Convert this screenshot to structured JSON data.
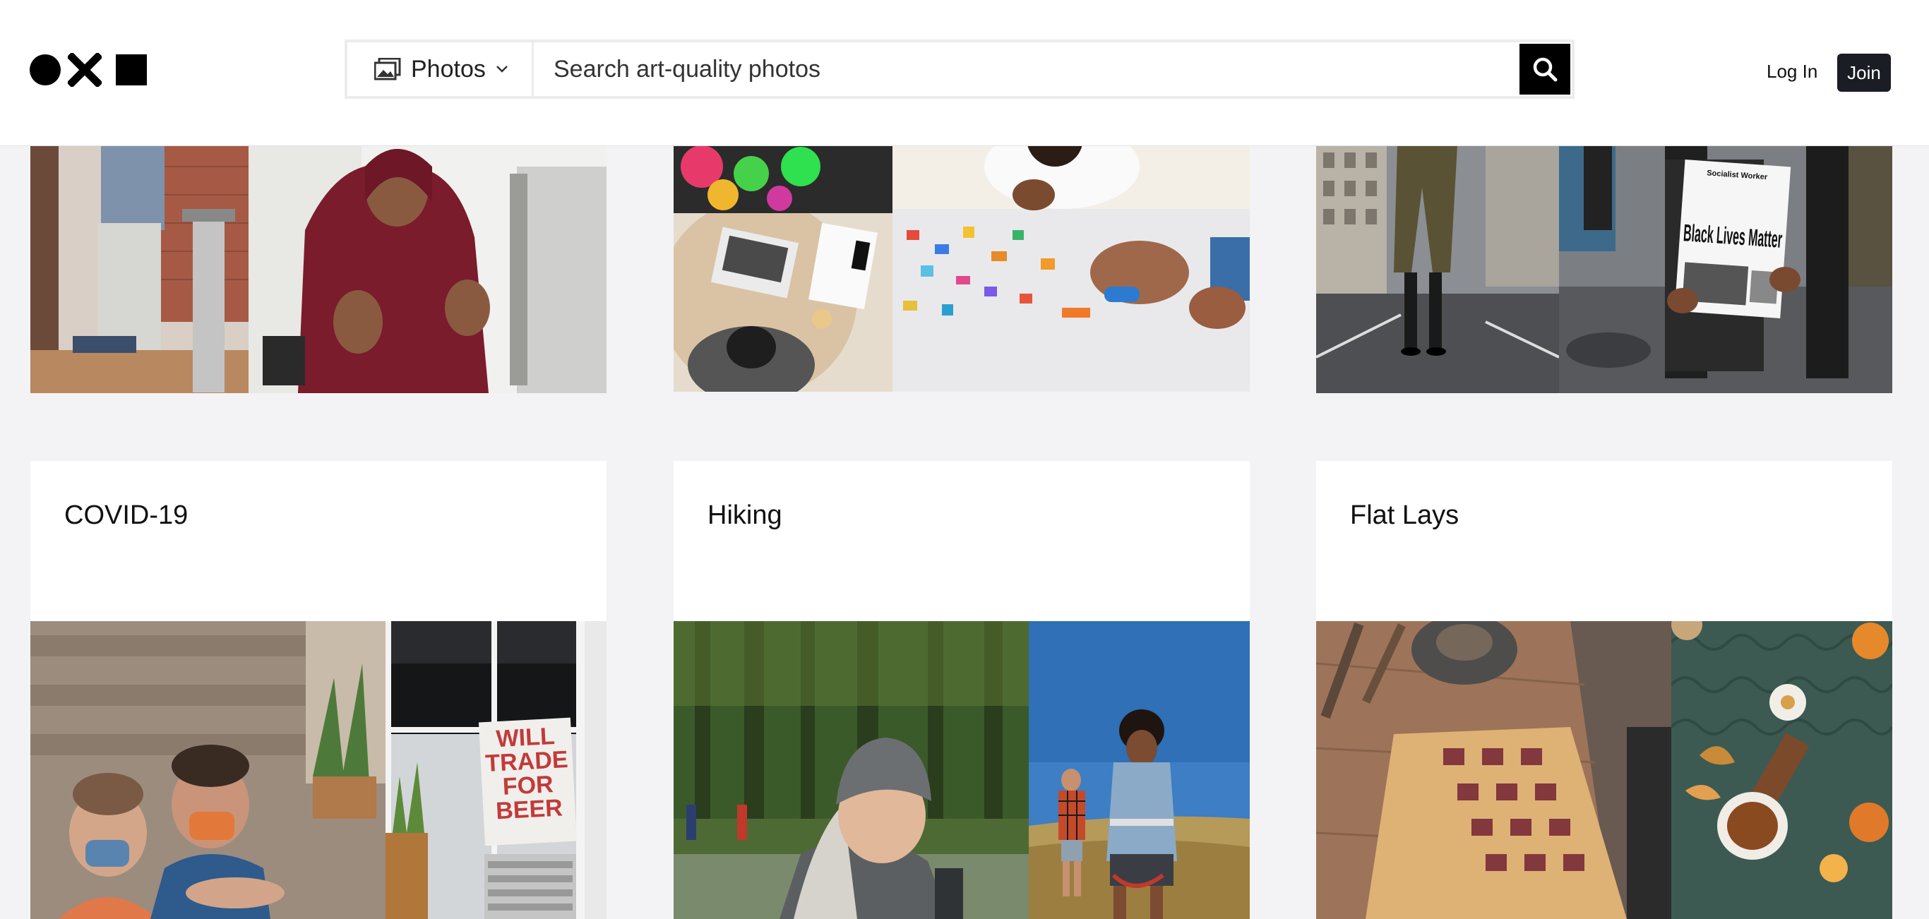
{
  "brand": {
    "logo_icon": "dot-x-square-logo"
  },
  "search": {
    "filter_label": "Photos",
    "filter_icon": "photos-icon",
    "placeholder": "Search art-quality photos",
    "button_icon": "search-icon"
  },
  "auth": {
    "login_label": "Log In",
    "join_label": "Join"
  },
  "colors": {
    "join_bg": "#1a1d24",
    "page_bg": "#f3f3f5"
  },
  "collections": [
    {
      "title": "COVID-19"
    },
    {
      "title": "Hiking"
    },
    {
      "title": "Flat Lays"
    }
  ],
  "images": {
    "sign_text": "WILL TRADE FOR BEER",
    "protest_sign_small": "Socialist Worker",
    "protest_sign_main": "Black Lives Matter"
  }
}
